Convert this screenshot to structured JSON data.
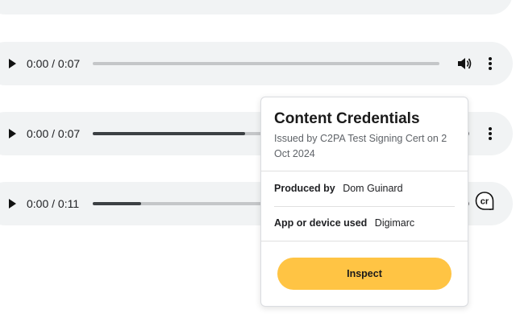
{
  "players": [
    {
      "time": "",
      "progress": 0
    },
    {
      "time": "0:00 / 0:07",
      "progress": 0
    },
    {
      "time": "0:00 / 0:07",
      "progress": 0.44
    },
    {
      "time": "0:00 / 0:11",
      "progress": 0.14
    }
  ],
  "popup": {
    "title": "Content Credentials",
    "issued": "Issued by C2PA Test Signing Cert on 2 Oct 2024",
    "produced_label": "Produced by",
    "produced_value": "Dom Guinard",
    "app_label": "App or device used",
    "app_value": "Digimarc",
    "inspect_label": "Inspect"
  },
  "badge": {
    "icon": "content-credentials-icon",
    "text": "cr"
  },
  "colors": {
    "player_bg": "#f1f3f4",
    "accent": "#ffc444",
    "track": "#c4c6c8",
    "track_fill": "#3c4043"
  }
}
